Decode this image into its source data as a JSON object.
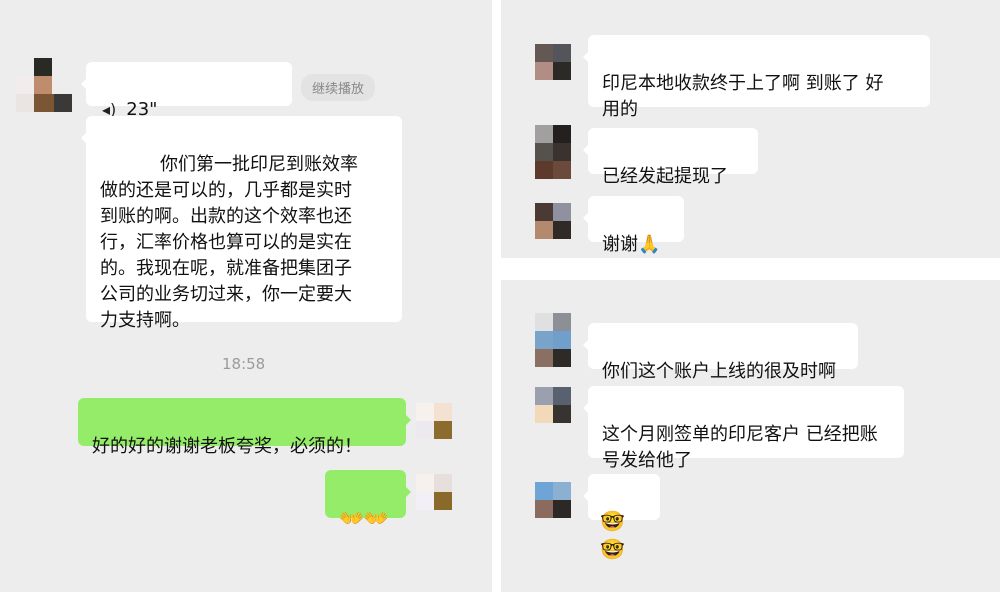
{
  "left": {
    "voice_duration": "23\"",
    "resume_label": "继续播放",
    "long_message": "你们第一批印尼到账效率\n做的还是可以的，几乎都是实时\n到账的啊。出款的这个效率也还\n行，汇率价格也算可以的是实在\n的。我现在呢，就准备把集团子\n公司的业务切过来，你一定要大\n力支持啊。",
    "timestamp": "18:58",
    "reply_text": "好的好的谢谢老板夸奖，必须的！",
    "reply_emoji": "👐👐"
  },
  "right_top": {
    "messages": [
      {
        "text": "印尼本地收款终于上了啊 到账了 好\n用的"
      },
      {
        "text": "已经发起提现了"
      },
      {
        "text": "谢谢🙏"
      }
    ]
  },
  "right_bottom": {
    "messages": [
      {
        "text": "你们这个账户上线的很及时啊"
      },
      {
        "text": "这个月刚签单的印尼客户 已经把账\n号发给他了"
      },
      {
        "text": "🤓🤓"
      }
    ]
  },
  "colors": {
    "panel_bg": "#ededed",
    "bubble_in": "#ffffff",
    "bubble_out": "#95ec69",
    "time_text": "#9b9b9b"
  },
  "icons": {
    "voice": "voice-wave-icon"
  }
}
